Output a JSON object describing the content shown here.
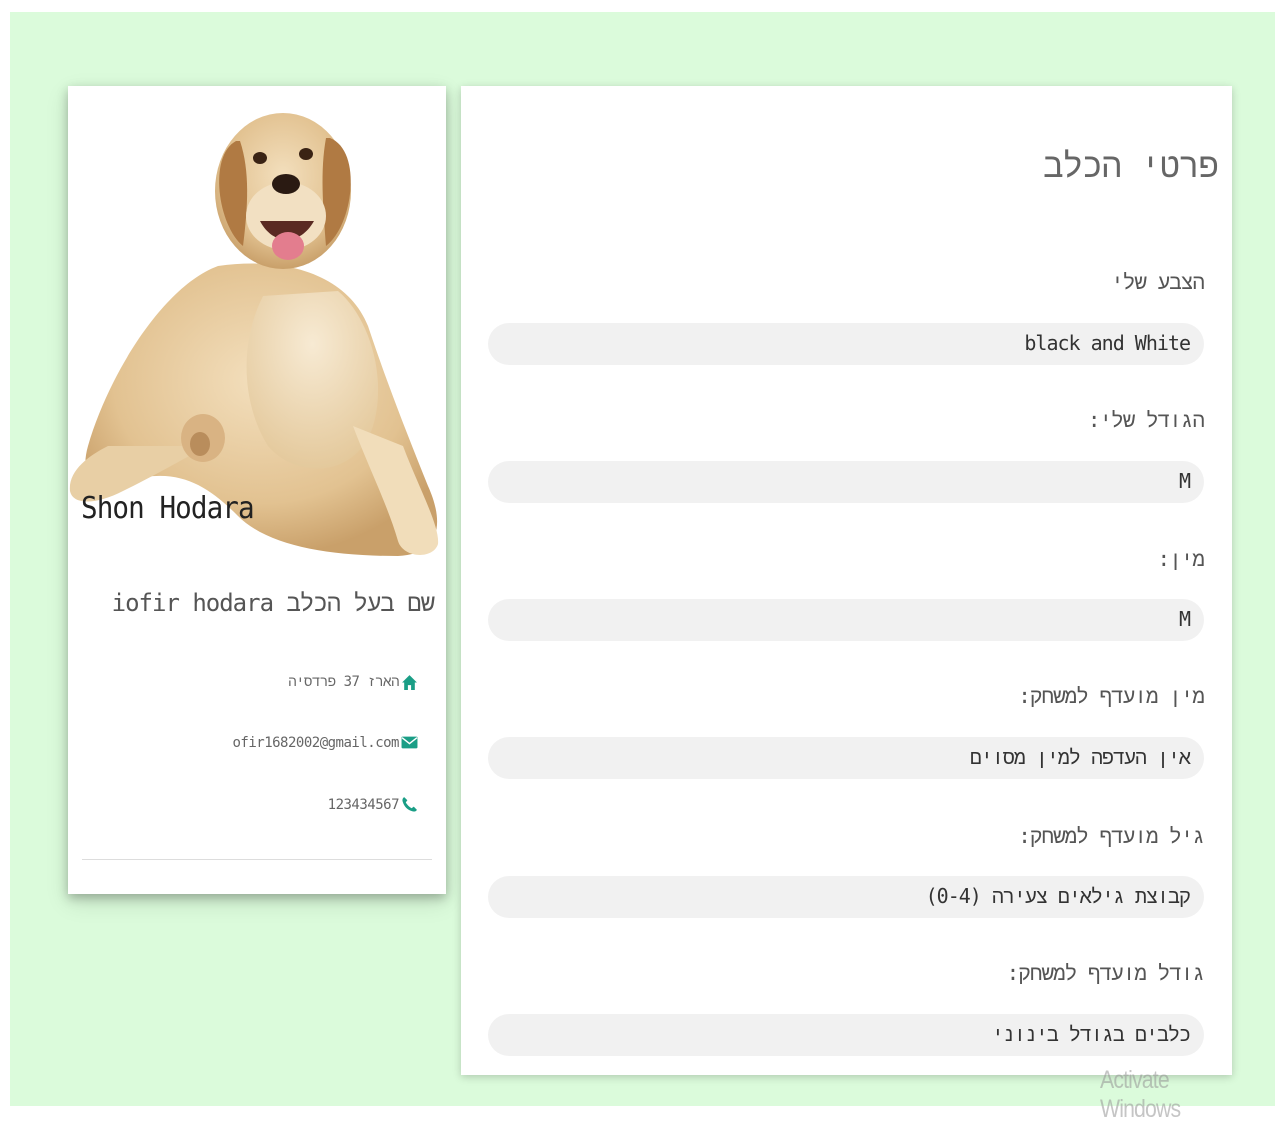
{
  "colors": {
    "page_background": "#dbfbdb",
    "icon_accent": "#1a9e86"
  },
  "profile": {
    "pet_name": "Shon Hodara",
    "photo_subject": "labrador-dog-photo",
    "owner_line": "שם בעל הכלב iofir hodara",
    "address": "הארז 37 פרדסיה",
    "email": "ofir1682002@gmail.com",
    "phone": "123434567",
    "icons": {
      "address": "home-icon",
      "email": "envelope-icon",
      "phone": "phone-icon"
    }
  },
  "details": {
    "title": "פרטי הכלב",
    "fields": [
      {
        "label": "הצבע שלי",
        "value": "black and White"
      },
      {
        "label": "הגודל שלי:",
        "value": "M"
      },
      {
        "label": "מין:",
        "value": "M"
      },
      {
        "label": "מין מועדף למשחק:",
        "value": "אין העדפה למין מסוים"
      },
      {
        "label": "גיל מועדף למשחק:",
        "value": "קבוצת גילאים צעירה (0-4)"
      },
      {
        "label": "גודל מועדף למשחק:",
        "value": "כלבים בגודל בינוני"
      }
    ]
  },
  "system": {
    "watermark": "Activate Windows"
  }
}
